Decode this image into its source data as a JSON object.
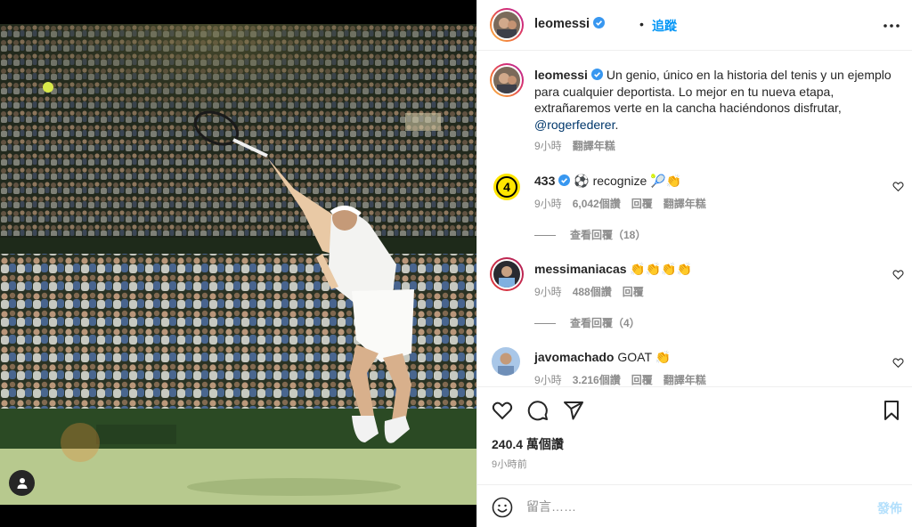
{
  "post": {
    "author": "leomessi",
    "follow_label": "追蹤",
    "dot": "•"
  },
  "caption": {
    "author": "leomessi",
    "text": " Un genio, único en la historia del tenis y un ejemplo para cualquier deportista. Lo mejor en tu nueva etapa, extrañaremos verte en la cancha haciéndonos disfrutar, ",
    "mention": "@rogerfederer",
    "mention_tail": ".",
    "time": "9小時",
    "translate": "翻譯年糕"
  },
  "comments": [
    {
      "author": "433",
      "text": " ⚽ recognize 🎾👏",
      "time": "9小時",
      "likes": "6,042個讚",
      "reply": "回覆",
      "translate": "翻譯年糕",
      "view_replies": "查看回覆（18）"
    },
    {
      "author": "messimaniacas",
      "text": " 👏👏👏👏",
      "time": "9小時",
      "likes": "488個讚",
      "reply": "回覆",
      "view_replies": "查看回覆（4）"
    },
    {
      "author": "javomachado",
      "text": " GOAT 👏",
      "time": "9小時",
      "likes": "3.216個讚",
      "reply": "回覆",
      "translate": "翻譯年糕"
    }
  ],
  "stats": {
    "likes": "240.4 萬個讚",
    "time": "9小時前"
  },
  "composer": {
    "placeholder": "留言……",
    "post_label": "發佈"
  },
  "colors": {
    "link": "#0095f6",
    "mention": "#00376b",
    "muted": "#8e8e8e",
    "verified": "#3897f0"
  },
  "icons": [
    "verified-badge-icon",
    "more-options-icon",
    "heart-icon",
    "comment-icon",
    "share-icon",
    "bookmark-icon",
    "emoji-icon",
    "user-tag-icon"
  ]
}
